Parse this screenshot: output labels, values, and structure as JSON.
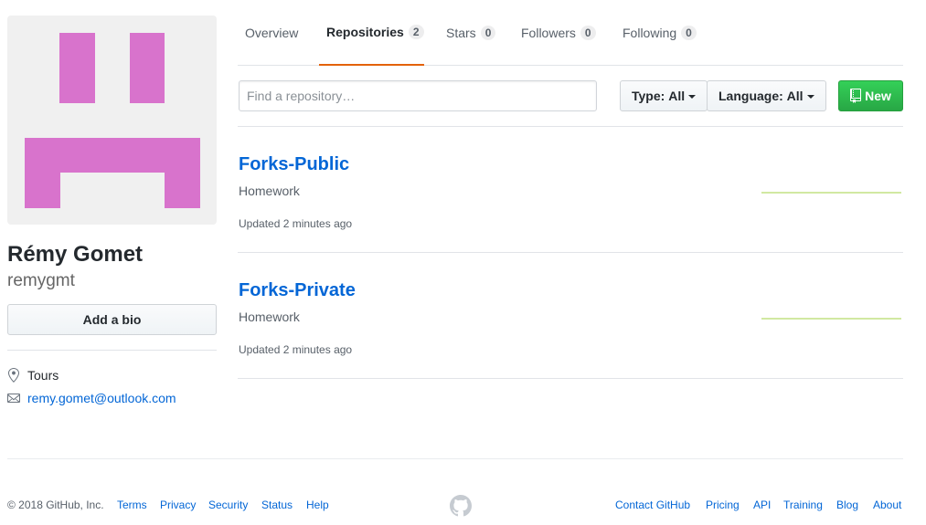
{
  "profile": {
    "fullname": "Rémy Gomet",
    "username": "remygmt",
    "add_bio_label": "Add a bio",
    "location": "Tours",
    "email": "remy.gomet@outlook.com",
    "avatar_color": "#d873cc"
  },
  "tabs": [
    {
      "label": "Overview",
      "count": null
    },
    {
      "label": "Repositories",
      "count": "2"
    },
    {
      "label": "Stars",
      "count": "0"
    },
    {
      "label": "Followers",
      "count": "0"
    },
    {
      "label": "Following",
      "count": "0"
    }
  ],
  "filters": {
    "search_placeholder": "Find a repository…",
    "type_key": "Type:",
    "type_value": "All",
    "language_key": "Language:",
    "language_value": "All",
    "new_label": "New"
  },
  "repos": [
    {
      "name": "Forks-Public",
      "description": "Homework",
      "updated": "Updated 2 minutes ago"
    },
    {
      "name": "Forks-Private",
      "description": "Homework",
      "updated": "Updated 2 minutes ago"
    }
  ],
  "footer": {
    "copyright": "© 2018 GitHub, Inc.",
    "left_links": [
      "Terms",
      "Privacy",
      "Security",
      "Status",
      "Help"
    ],
    "right_links": [
      "Contact GitHub",
      "Pricing",
      "API",
      "Training",
      "Blog",
      "About"
    ]
  },
  "colors": {
    "accent_tab": "#e36209",
    "link": "#0366d6",
    "new_button": "#28a745"
  }
}
